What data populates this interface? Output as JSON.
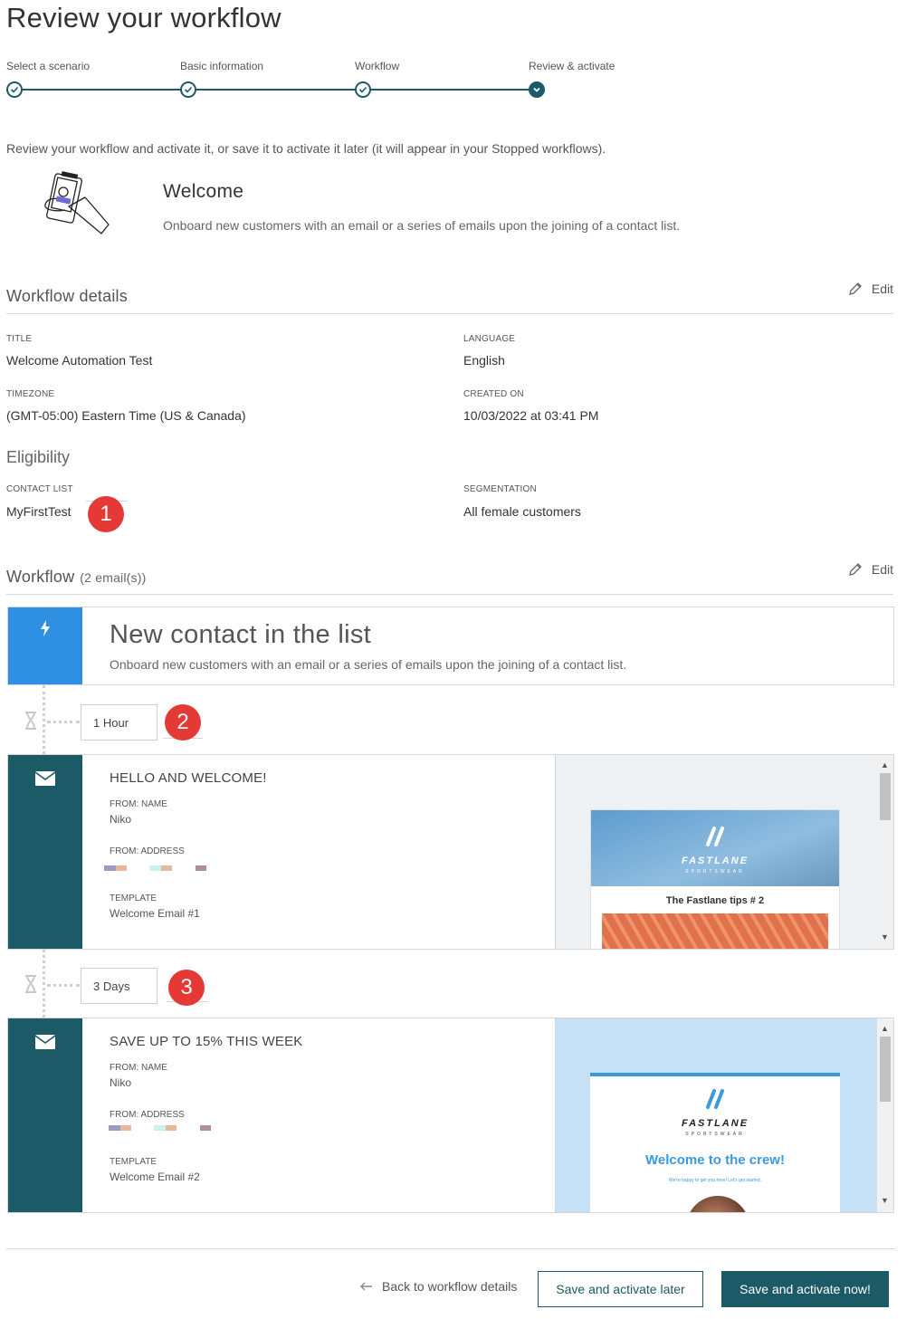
{
  "page": {
    "title": "Review your workflow"
  },
  "stepper": {
    "steps": [
      {
        "label": "Select a scenario",
        "state": "done"
      },
      {
        "label": "Basic information",
        "state": "done"
      },
      {
        "label": "Workflow",
        "state": "done"
      },
      {
        "label": "Review & activate",
        "state": "active"
      }
    ],
    "color": "#1b5a66"
  },
  "intro": "Review your workflow and activate it, or save it to activate it later (it will appear in your Stopped workflows).",
  "scenario": {
    "title": "Welcome",
    "description": "Onboard new customers with an email or a series of emails upon the joining of a contact list."
  },
  "details": {
    "section_title": "Workflow details",
    "edit_label": "Edit",
    "title_label": "TITLE",
    "title_value": "Welcome Automation Test",
    "language_label": "LANGUAGE",
    "language_value": "English",
    "timezone_label": "TIMEZONE",
    "timezone_value": "(GMT-05:00) Eastern Time (US & Canada)",
    "created_label": "CREATED ON",
    "created_value": "10/03/2022 at 03:41 PM"
  },
  "eligibility": {
    "title": "Eligibility",
    "contact_list_label": "CONTACT LIST",
    "contact_list_value": "MyFirstTest",
    "segmentation_label": "SEGMENTATION",
    "segmentation_value": "All female customers"
  },
  "workflow": {
    "section_title": "Workflow",
    "count": "(2 email(s))",
    "edit_label": "Edit",
    "trigger": {
      "title": "New contact in the list",
      "description": "Onboard new customers with an email or a series of emails upon the joining of a contact list.",
      "color": "#2f8fe0"
    },
    "delays": [
      "1 Hour",
      "3 Days"
    ],
    "emails": [
      {
        "subject": "HELLO AND WELCOME!",
        "from_name_label": "FROM: NAME",
        "from_name": "Niko",
        "from_address_label": "FROM: ADDRESS",
        "template_label": "TEMPLATE",
        "template": "Welcome Email #1",
        "preview": {
          "brand": "FASTLANE",
          "brand_sub": "SPORTSWEAR",
          "headline": "The Fastlane tips # 2"
        }
      },
      {
        "subject": "SAVE UP TO 15% THIS WEEK",
        "from_name_label": "FROM: NAME",
        "from_name": "Niko",
        "from_address_label": "FROM: ADDRESS",
        "template_label": "TEMPLATE",
        "template": "Welcome Email #2",
        "preview": {
          "brand": "FASTLANE",
          "brand_sub": "SPORTSWEAR",
          "headline": "Welcome to the crew!",
          "subline": "We're happy to get you here! Let's get started."
        }
      }
    ]
  },
  "annotations": [
    "1",
    "2",
    "3"
  ],
  "footer": {
    "back_label": "Back to workflow details",
    "later_label": "Save and activate later",
    "now_label": "Save and activate now!"
  },
  "colors": {
    "primary": "#1b5a66",
    "accent_red": "#e53935",
    "trigger_blue": "#2f8fe0"
  }
}
